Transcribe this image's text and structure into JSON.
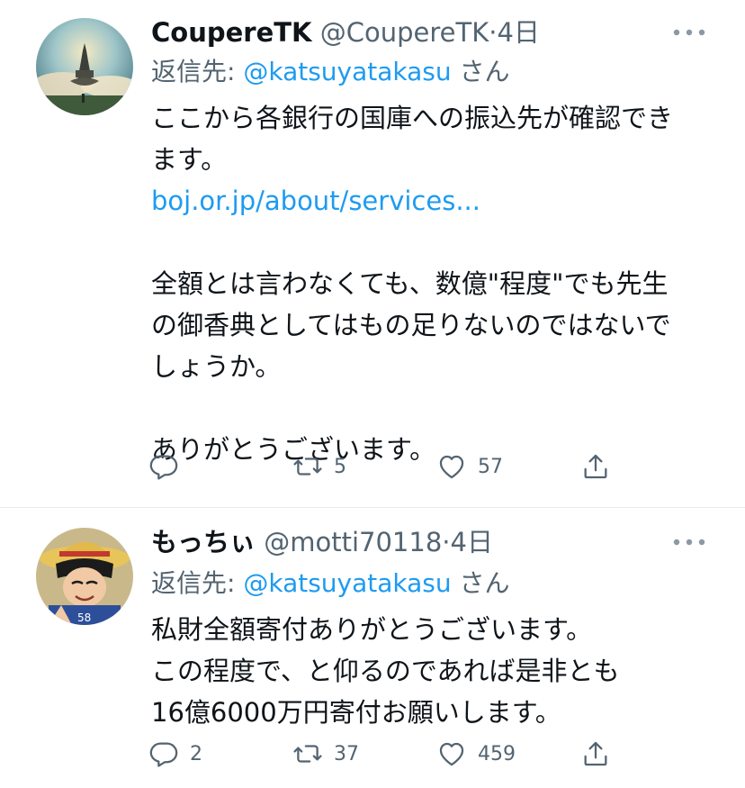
{
  "tweets": [
    {
      "display_name": "CoupereTK",
      "handle": "@CoupereTK",
      "dot": "·",
      "time": "4日",
      "reply_prefix": "返信先: ",
      "reply_mention": "@katsuyatakasu",
      "reply_suffix": " さん",
      "body": {
        "l1": "ここから各銀行の国庫への振込先が確認でき",
        "l2": "ます。",
        "link": "boj.or.jp/about/services...",
        "l4": "全額とは言わなくても、数億\"程度\"でも先生",
        "l5": "の御香典としてはもの足りないのではないで",
        "l6": "しょうか。",
        "l8": "ありがとうございます。"
      },
      "counts": {
        "reply": "",
        "retweet": "5",
        "like": "57"
      }
    },
    {
      "display_name": "もっちぃ",
      "handle": "@motti70118",
      "dot": "·",
      "time": "4日",
      "reply_prefix": "返信先: ",
      "reply_mention": "@katsuyatakasu",
      "reply_suffix": " さん",
      "body": {
        "l1": "私財全額寄付ありがとうございます。",
        "l2": "この程度で、と仰るのであれば是非とも",
        "l3": "16億6000万円寄付お願いします。"
      },
      "counts": {
        "reply": "2",
        "retweet": "37",
        "like": "459"
      }
    }
  ],
  "icons": {
    "more": "more-icon",
    "reply": "reply-icon",
    "retweet": "retweet-icon",
    "like": "heart-icon",
    "share": "share-icon"
  },
  "colors": {
    "text": "#0f1419",
    "secondary": "#536471",
    "link": "#1d9bf0",
    "divider": "#e6ecf0"
  }
}
